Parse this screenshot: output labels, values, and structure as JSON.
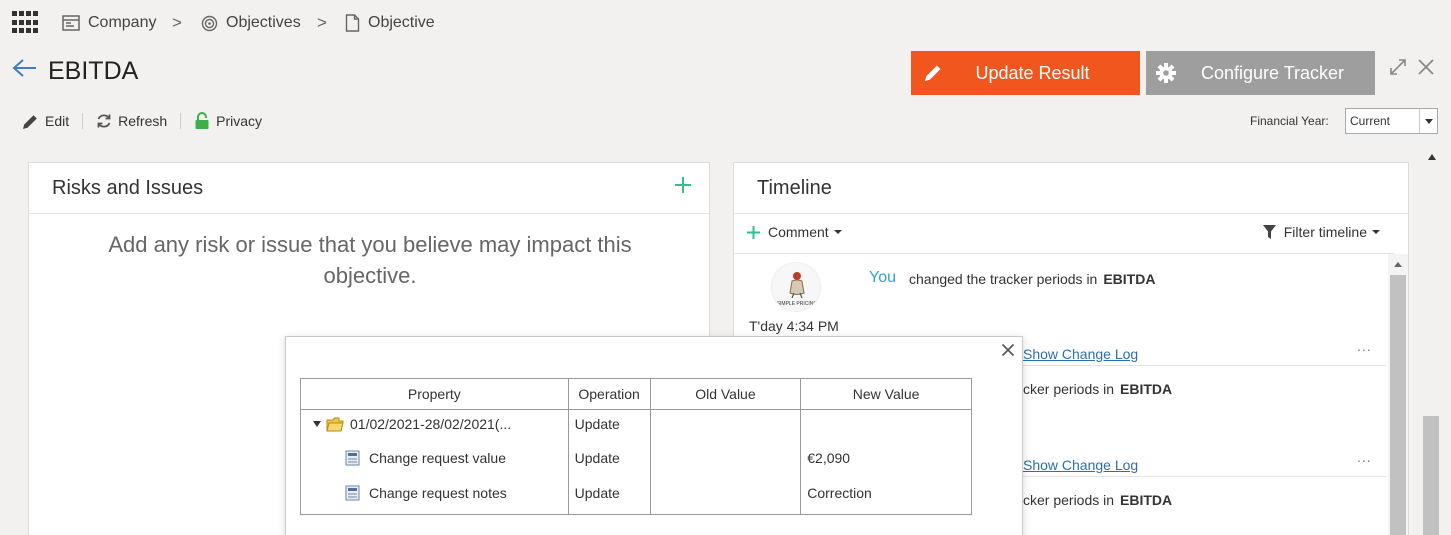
{
  "breadcrumb": [
    {
      "label": "Company",
      "icon": "company-icon"
    },
    {
      "label": "Objectives",
      "icon": "target-icon"
    },
    {
      "label": "Objective",
      "icon": "document-icon"
    }
  ],
  "page": {
    "title": "EBITDA"
  },
  "actions": {
    "update_result": "Update Result",
    "configure_tracker": "Configure Tracker"
  },
  "toolbar": {
    "edit": "Edit",
    "refresh": "Refresh",
    "privacy": "Privacy"
  },
  "financial_year": {
    "label": "Financial Year:",
    "selected": "Current"
  },
  "risks": {
    "title": "Risks and Issues",
    "empty_message": "Add any risk or issue that you believe may impact this objective."
  },
  "timeline": {
    "title": "Timeline",
    "comment_label": "Comment",
    "filter_label": "Filter timeline",
    "avatar_text": "SIMPLE PRICING",
    "entries": [
      {
        "who": "You",
        "text": "changed the tracker periods in",
        "target": "EBITDA",
        "time": "T'day 4:34 PM",
        "log_link": "Show Change Log",
        "more": "..."
      },
      {
        "text": "cker periods in",
        "target": "EBITDA",
        "log_link": "Show Change Log",
        "more": "..."
      },
      {
        "text": "cker periods in",
        "target": "EBITDA"
      }
    ]
  },
  "change_log": {
    "headers": [
      "Property",
      "Operation",
      "Old Value",
      "New Value"
    ],
    "rows": [
      {
        "property": "01/02/2021-28/02/2021(...",
        "operation": "Update",
        "old_value": "",
        "new_value": ""
      },
      {
        "property": "Change request value",
        "operation": "Update",
        "old_value": "",
        "new_value": "€2,090"
      },
      {
        "property": "Change request notes",
        "operation": "Update",
        "old_value": "",
        "new_value": "Correction"
      }
    ]
  },
  "colors": {
    "accent_orange": "#f0561d",
    "button_grey": "#9e9e9e",
    "link_blue": "#2a6fb0",
    "you_blue": "#2aa3d8",
    "plus_green": "#2fbf8a"
  }
}
